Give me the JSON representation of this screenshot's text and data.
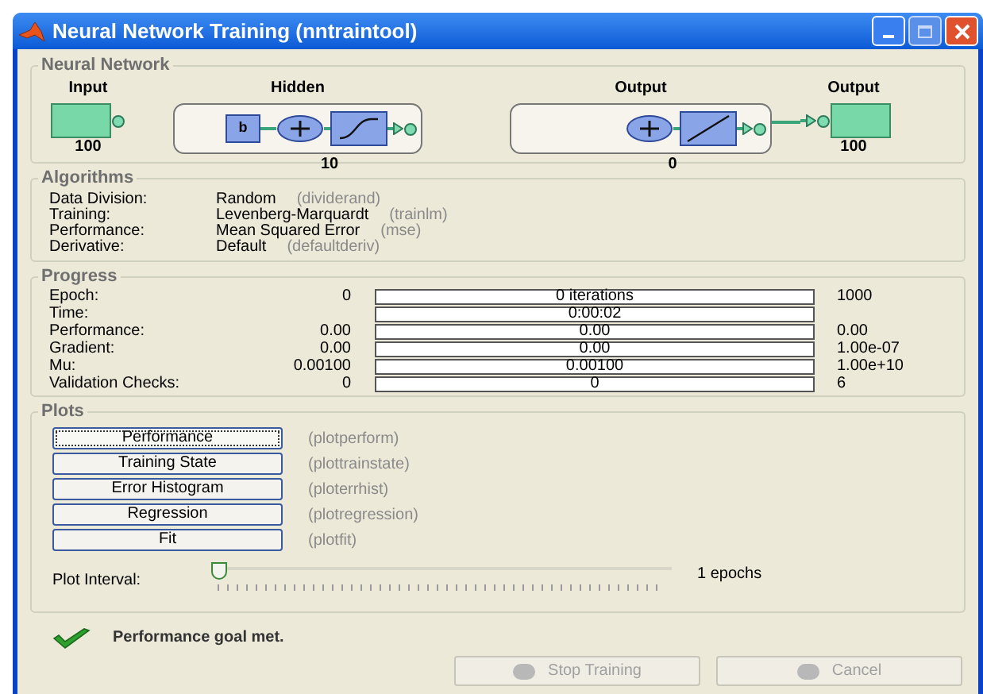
{
  "window": {
    "title": "Neural Network Training (nntraintool)"
  },
  "network": {
    "title": "Neural Network",
    "input": {
      "label": "Input",
      "size": "100"
    },
    "layers": [
      {
        "label": "Hidden",
        "size": "10",
        "bias": "b",
        "kind": "sigmoid"
      },
      {
        "label": "Output",
        "size": "0",
        "kind": "linear"
      }
    ],
    "output": {
      "label": "Output",
      "size": "100"
    }
  },
  "algorithms": {
    "title": "Algorithms",
    "rows": [
      {
        "label": "Data Division:",
        "value": "Random",
        "func": "(dividerand)"
      },
      {
        "label": "Training:",
        "value": "Levenberg-Marquardt",
        "func": "(trainlm)"
      },
      {
        "label": "Performance:",
        "value": "Mean Squared Error",
        "func": "(mse)"
      },
      {
        "label": "Derivative:",
        "value": "Default",
        "func": "(defaultderiv)"
      }
    ]
  },
  "progress": {
    "title": "Progress",
    "rows": [
      {
        "label": "Epoch:",
        "start": "0",
        "bar": "0 iterations",
        "end": "1000",
        "level": 0
      },
      {
        "label": "Time:",
        "bar": "0:00:02",
        "level": 0
      },
      {
        "label": "Performance:",
        "start": "0.00",
        "bar": "0.00",
        "end": "0.00",
        "level": 0
      },
      {
        "label": "Gradient:",
        "start": "0.00",
        "bar": "0.00",
        "end": "1.00e-07",
        "level": 0
      },
      {
        "label": "Mu:",
        "start": "0.00100",
        "bar": "0.00100",
        "end": "1.00e+10",
        "level": 0
      },
      {
        "label": "Validation Checks:",
        "start": "0",
        "bar": "0",
        "end": "6",
        "level": 0
      }
    ]
  },
  "plots": {
    "title": "Plots",
    "buttons": [
      {
        "label": "Performance",
        "func": "(plotperform)",
        "focused": true
      },
      {
        "label": "Training State",
        "func": "(plottrainstate)",
        "focused": false
      },
      {
        "label": "Error Histogram",
        "func": "(ploterrhist)",
        "focused": false
      },
      {
        "label": "Regression",
        "func": "(plotregression)",
        "focused": false
      },
      {
        "label": "Fit",
        "func": "(plotfit)",
        "focused": false
      }
    ],
    "interval": {
      "label": "Plot Interval:",
      "level": 0,
      "reading": "1 epochs"
    }
  },
  "status": {
    "message": "Performance goal met.",
    "success": true
  },
  "buttons": [
    {
      "label": "Stop Training",
      "disabled": true
    },
    {
      "label": "Cancel",
      "disabled": true
    }
  ]
}
